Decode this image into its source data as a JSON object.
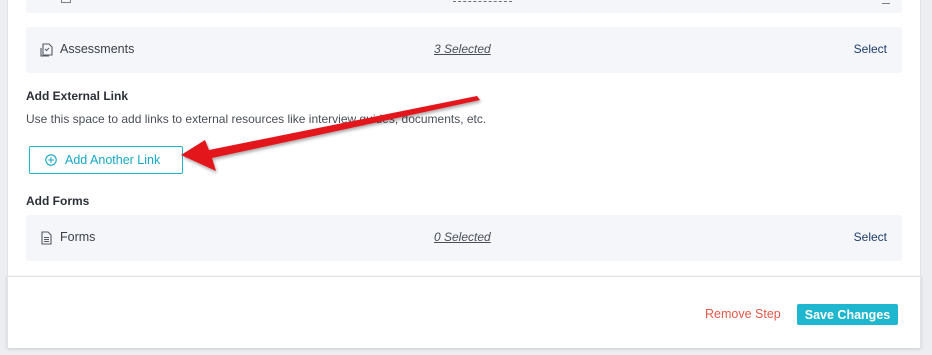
{
  "sections": {
    "assessments": {
      "icon": "assessment-doc-icon",
      "label": "Assessments",
      "selected": "3 Selected",
      "action": "Select"
    },
    "external_link": {
      "title": "Add External Link",
      "description": "Use this space to add links to external resources like interview guides, documents, etc.",
      "button_label": "Add Another Link",
      "button_icon": "plus-circle-icon"
    },
    "forms": {
      "title": "Add Forms",
      "row": {
        "icon": "form-doc-icon",
        "label": "Forms",
        "selected": "0 Selected",
        "action": "Select"
      }
    }
  },
  "footer": {
    "remove_label": "Remove Step",
    "save_label": "Save Changes"
  },
  "annotation": {
    "icon": "red-arrow-annotation"
  },
  "colors": {
    "accent": "#1fb6cf",
    "danger": "#e45848",
    "link": "#1f3d6b",
    "row_bg": "#f4f6f9",
    "arrow": "#e3141b"
  }
}
